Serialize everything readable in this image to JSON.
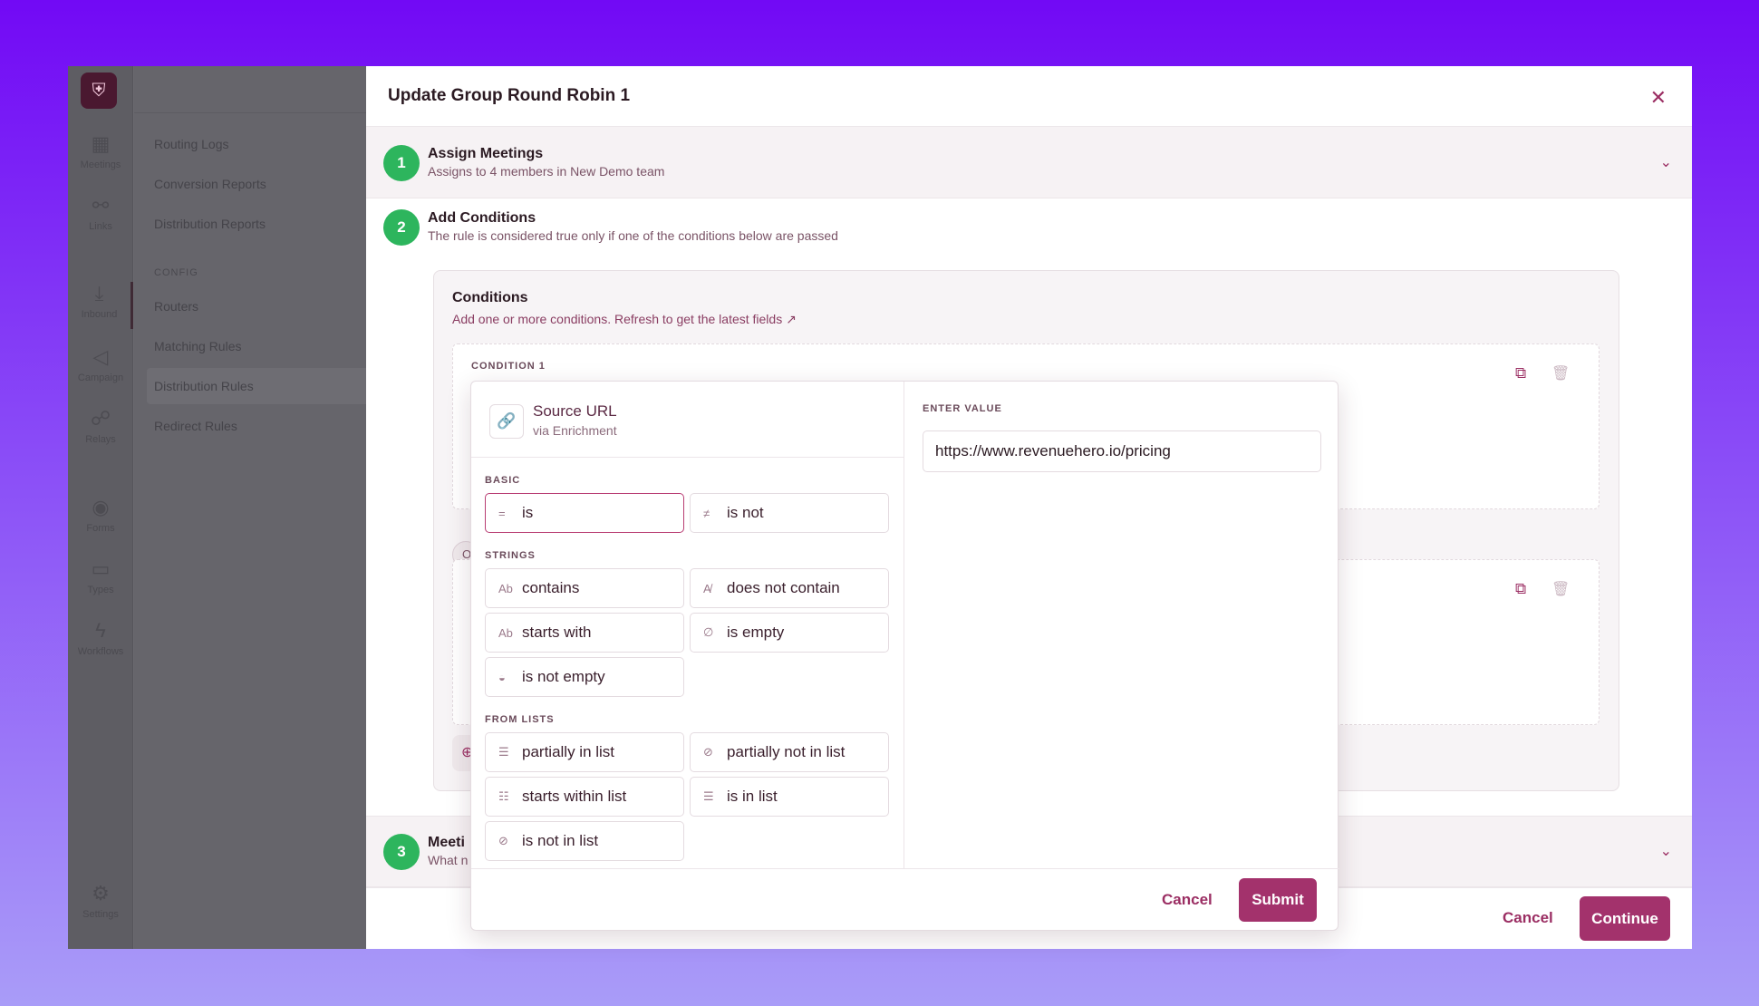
{
  "sidebar": {
    "items": [
      {
        "label": "Meetings",
        "icon": "calendar-icon"
      },
      {
        "label": "Links",
        "icon": "link-icon"
      },
      {
        "label": "Inbound",
        "icon": "inbound-icon"
      },
      {
        "label": "Campaign",
        "icon": "megaphone-icon"
      },
      {
        "label": "Relays",
        "icon": "relay-icon"
      },
      {
        "label": "Forms",
        "icon": "forms-icon"
      },
      {
        "label": "Types",
        "icon": "types-icon"
      },
      {
        "label": "Workflows",
        "icon": "bolt-icon"
      },
      {
        "label": "Settings",
        "icon": "gear-icon"
      }
    ]
  },
  "subnav": {
    "links": [
      "Routing Logs",
      "Conversion Reports",
      "Distribution Reports"
    ],
    "section": "CONFIG",
    "config_links": [
      "Routers",
      "Matching Rules",
      "Distribution Rules",
      "Redirect Rules"
    ]
  },
  "drawer": {
    "title": "Update Group Round Robin 1",
    "steps": [
      {
        "num": "1",
        "title": "Assign Meetings",
        "subtitle": "Assigns to 4 members in New Demo team"
      },
      {
        "num": "2",
        "title": "Add Conditions",
        "subtitle": "The rule is considered true only if one of the conditions below are passed"
      },
      {
        "num": "3",
        "title": "Meeti",
        "subtitle": "What n"
      }
    ],
    "conditions": {
      "title": "Conditions",
      "subtitle": "Add one or more conditions. Refresh to get the latest fields ↗",
      "condition_label": "CONDITION 1",
      "or_label": "O"
    },
    "footer": {
      "cancel": "Cancel",
      "continue": "Continue"
    }
  },
  "popover": {
    "field": {
      "name": "Source URL",
      "source": "via Enrichment"
    },
    "groups": {
      "basic": "BASIC",
      "strings": "STRINGS",
      "lists": "FROM LISTS"
    },
    "operators": {
      "is": "is",
      "is_not": "is not",
      "contains": "contains",
      "does_not_contain": "does not contain",
      "starts_with": "starts with",
      "is_empty": "is empty",
      "is_not_empty": "is not empty",
      "partially_in_list": "partially in list",
      "partially_not_in_list": "partially not in list",
      "starts_within_list": "starts within list",
      "is_in_list": "is in list",
      "is_not_in_list": "is not in list"
    },
    "selected_operator": "is",
    "value_label": "ENTER VALUE",
    "value": "https://www.revenuehero.io/pricing",
    "cancel": "Cancel",
    "submit": "Submit"
  },
  "colors": {
    "accent": "#a3326c",
    "step_badge": "#2db55d",
    "background_top": "#7209f5",
    "background_bottom": "#a99cf8"
  }
}
